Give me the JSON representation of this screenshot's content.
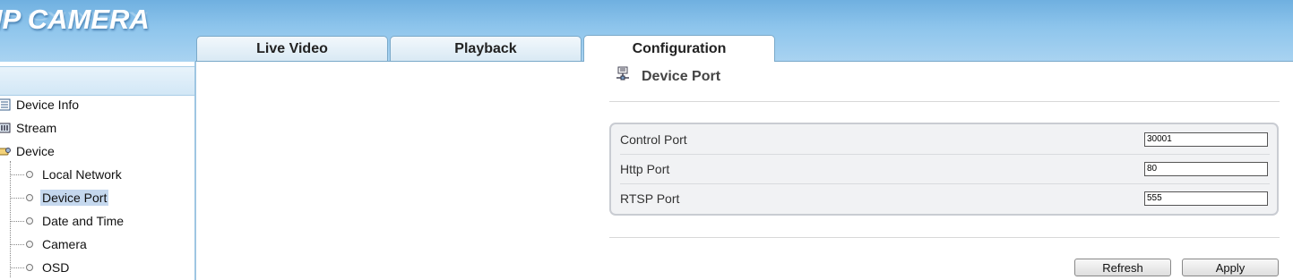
{
  "app": {
    "brand": "IP CAMERA"
  },
  "tabs": [
    {
      "label": "Live Video"
    },
    {
      "label": "Playback"
    },
    {
      "label": "Configuration"
    }
  ],
  "sidebar": {
    "items": [
      {
        "label": "Device Info",
        "icon": "list-icon"
      },
      {
        "label": "Stream",
        "icon": "stream-icon"
      },
      {
        "label": "Device",
        "icon": "device-icon"
      }
    ],
    "subitems": [
      {
        "label": "Local Network"
      },
      {
        "label": "Device Port",
        "selected": true
      },
      {
        "label": "Date and Time"
      },
      {
        "label": "Camera"
      },
      {
        "label": "OSD"
      }
    ]
  },
  "page": {
    "title": "Device Port",
    "fields": [
      {
        "label": "Control Port",
        "value": "30001"
      },
      {
        "label": "Http Port",
        "value": "80"
      },
      {
        "label": "RTSP Port",
        "value": "555"
      }
    ],
    "buttons": {
      "refresh": "Refresh",
      "apply": "Apply"
    }
  },
  "colors": {
    "header": "#8ec5ec",
    "selection": "#c5d8ee",
    "panel": "#f1f2f4"
  }
}
